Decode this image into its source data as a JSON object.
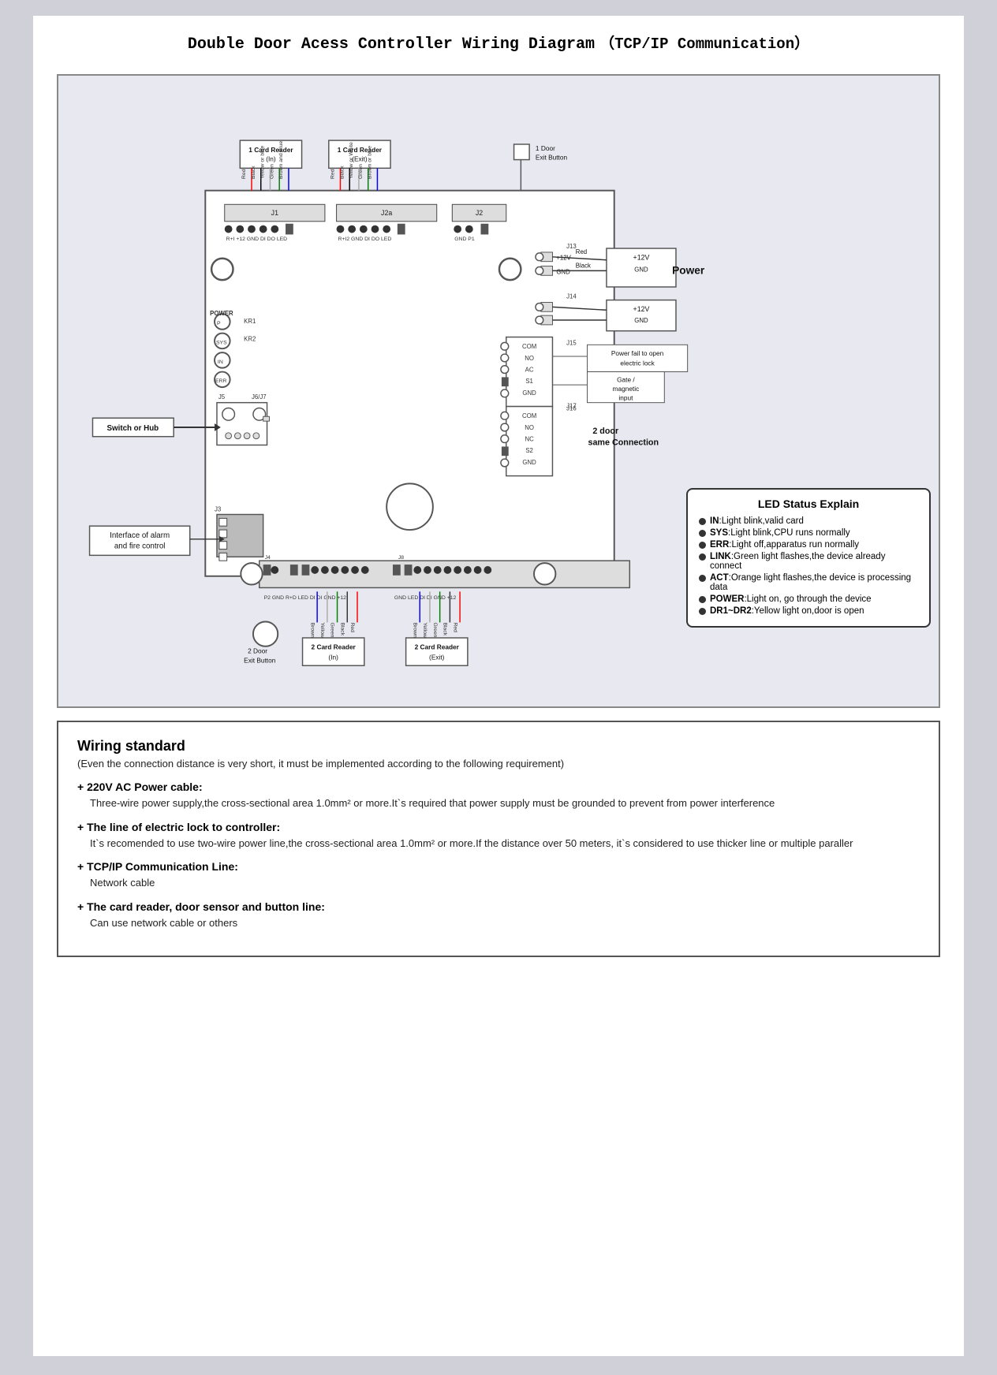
{
  "page": {
    "title": "Double Door Acess Controller Wiring Diagram",
    "title_sub": "（TCP/IP Communication）"
  },
  "diagram": {
    "labels": {
      "card_reader_in": "1 Card Reader\n(In)",
      "card_reader_exit": "1 Card Reader\n(Exit)",
      "door_exit_button_1": "1 Door\nExit Button",
      "switch_or_hub": "Switch or Hub",
      "interface_alarm": "Interface of alarm\nand fire control",
      "power": "Power",
      "two_door_same_connection": "2 door\nsame Connection",
      "power_fail_label": "Power fail to open\nelectric lock",
      "gate_magnetic_input": "Gate /\nmagnetic\ninput",
      "red": "Red",
      "black": "Black",
      "plus12v": "+12V",
      "gnd": "GND",
      "card_reader_2_in": "2 Card Reader\n(In)",
      "card_reader_2_exit": "2 Card Reader\n(Exit)",
      "door_exit_button_2": "2 Door\nExit Button"
    }
  },
  "led_status": {
    "title": "LED Status Explain",
    "items": [
      {
        "label": "IN",
        "text": ":Light blink,valid card"
      },
      {
        "label": "SYS",
        "text": ":Light blink,CPU runs normally"
      },
      {
        "label": "ERR",
        "text": ":Light off,apparatus run normally"
      },
      {
        "label": "LINK",
        "text": ":Green light flashes,the device already connect"
      },
      {
        "label": "ACT",
        "text": ":Orange light flashes,the device is processing data"
      },
      {
        "label": "POWER",
        "text": ":Light on, go through the device"
      },
      {
        "label": "DR1~DR2",
        "text": ":Yellow light on,door is open"
      }
    ]
  },
  "wiring_standard": {
    "title": "Wiring standard",
    "subtitle": "(Even the connection distance  is very short, it must be implemented  according to the following requirement)",
    "items": [
      {
        "header": "+ 220V AC Power cable:",
        "body": "Three-wire power supply,the cross-sectional area 1.0mm² or more.It`s required that power supply must be grounded to prevent from power interference"
      },
      {
        "header": "+ The line of electric lock to controller:",
        "body": "It`s recomended to use two-wire power line,the cross-sectional area 1.0mm²  or more.If the distance over 50 meters, it`s considered to use  thicker line or multiple paraller"
      },
      {
        "header": "+ TCP/IP  Communication Line:",
        "body": "Network cable"
      },
      {
        "header": "+ The card reader, door sensor and button line:",
        "body": "Can use network cable or others"
      }
    ]
  }
}
